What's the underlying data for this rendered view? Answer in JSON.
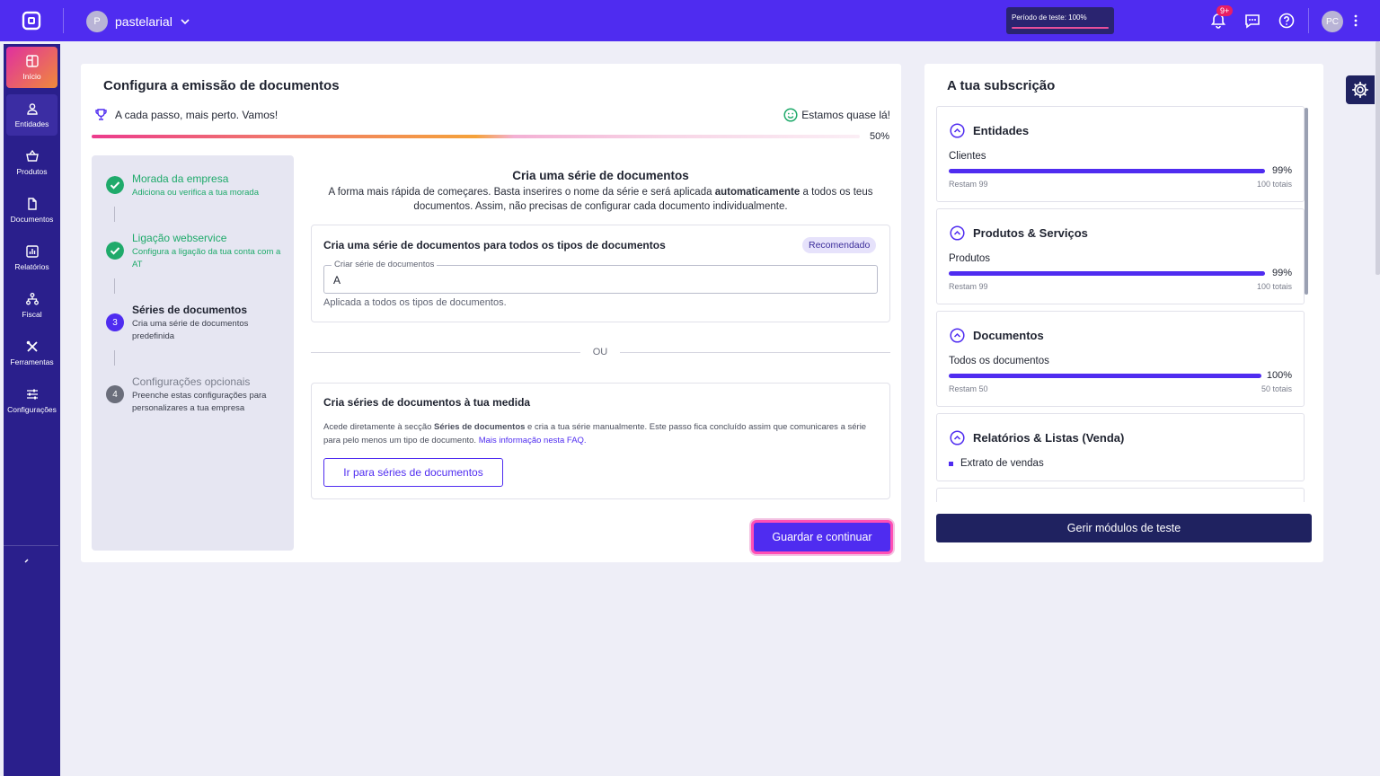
{
  "topbar": {
    "account_initial": "P",
    "account_name": "pastelarial",
    "trial_label": "Período de teste: 100%",
    "notif_badge": "9+",
    "user_initials": "PC"
  },
  "sidebar": {
    "items": [
      {
        "label": "Início",
        "icon": "home-icon"
      },
      {
        "label": "Entidades",
        "icon": "person-icon"
      },
      {
        "label": "Produtos",
        "icon": "basket-icon"
      },
      {
        "label": "Documentos",
        "icon": "document-icon"
      },
      {
        "label": "Relatórios",
        "icon": "chart-icon"
      },
      {
        "label": "Fiscal",
        "icon": "network-icon"
      },
      {
        "label": "Ferramentas",
        "icon": "tools-icon"
      },
      {
        "label": "Configurações",
        "icon": "sliders-icon"
      }
    ]
  },
  "setup": {
    "title": "Configura a emissão de documentos",
    "motto": "A cada passo, mais perto. Vamos!",
    "almost": "Estamos quase lá!",
    "progress_pct": "50%",
    "progress_value": 0.5,
    "steps": [
      {
        "num": "",
        "title": "Morada da empresa",
        "desc": "Adiciona ou verifica a tua morada",
        "status": "done"
      },
      {
        "num": "",
        "title": "Ligação webservice",
        "desc": "Configura a ligação da tua conta com a AT",
        "status": "done"
      },
      {
        "num": "3",
        "title": "Séries de documentos",
        "desc": "Cria uma série de documentos predefinida",
        "status": "current"
      },
      {
        "num": "4",
        "title": "Configurações opcionais",
        "desc": "Preenche estas configurações para personalizares a tua empresa",
        "status": "todo"
      }
    ],
    "section_title": "Cria uma série de documentos",
    "section_desc_a": "A forma mais rápida de começares. Basta inserires o nome da série e será aplicada ",
    "section_desc_b": "automaticamente",
    "section_desc_c": " a todos os teus documentos. Assim, não precisas de configurar cada documento individualmente.",
    "box1_title": "Cria uma série de documentos para todos os tipos de documentos",
    "recommended": "Recomendado",
    "field_label": "Criar série de documentos",
    "field_value": "A",
    "helper": "Aplicada a todos os tipos de documentos.",
    "or": "OU",
    "box2_title": "Cria séries de documentos à tua medida",
    "box2_desc_a": "Acede diretamente à secção ",
    "box2_desc_b": "Séries de documentos",
    "box2_desc_c": " e cria a tua série manualmente. Este passo fica concluído assim que comunicares a série para pelo menos um tipo de documento. ",
    "box2_link": "Mais informação nesta FAQ.",
    "box2_button": "Ir para séries de documentos",
    "save_button": "Guardar e continuar"
  },
  "subscription": {
    "title": "A tua subscrição",
    "modules": [
      {
        "name": "Entidades",
        "item": "Clientes",
        "pct": "99%",
        "value": 0.99,
        "remaining": "Restam 99",
        "total": "100 totais"
      },
      {
        "name": "Produtos & Serviços",
        "item": "Produtos",
        "pct": "99%",
        "value": 0.99,
        "remaining": "Restam 99",
        "total": "100 totais"
      },
      {
        "name": "Documentos",
        "item": "Todos os documentos",
        "pct": "100%",
        "value": 1.0,
        "remaining": "Restam 50",
        "total": "50 totais"
      },
      {
        "name": "Relatórios & Listas (Venda)",
        "item": "Extrato de vendas"
      }
    ],
    "manage_button": "Gerir módulos de teste"
  },
  "colors": {
    "brand": "#4f2cf0",
    "sidebar": "#2a1f8c",
    "success": "#1faa6b",
    "accent_pink": "#ff4fb5"
  }
}
